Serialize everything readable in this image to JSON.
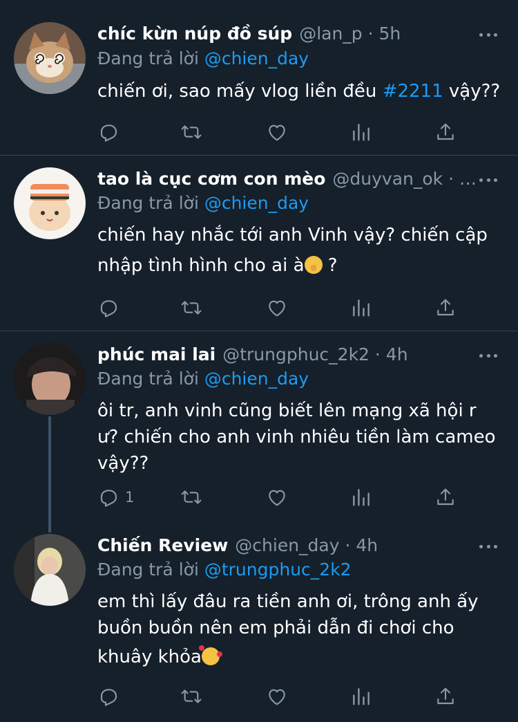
{
  "tweets": [
    {
      "name": "chíc kừn núp đồ súp",
      "handle": "@lan_p",
      "time": "5h",
      "meta": "@lan_p · 5h",
      "reply_prefix": "Đang trả lời ",
      "reply_to": "@chien_day",
      "text_before": "chiến ơi, sao mấy vlog liền đều ",
      "hashtag": "#2211",
      "text_after": " vậy??",
      "avatar": "cat-with-spiral-eyes",
      "reply_count": ""
    },
    {
      "name": "tao là cục cơm con mèo",
      "meta": "@duyvan_ok · …",
      "reply_prefix": "Đang trả lời ",
      "reply_to": "@chien_day",
      "text_line1": "chiến hay nhắc tới anh Vinh vậy? chiến cập",
      "text_line2": "nhập tình hình cho ai à",
      "text_line2_end": " ?",
      "emoji": "shushing-face-emoji",
      "avatar": "cat-with-sushi-hat",
      "reply_count": ""
    },
    {
      "name": "phúc mai lai",
      "meta": "@trungphuc_2k2 · 4h",
      "reply_prefix": "Đang trả lời ",
      "reply_to": "@chien_day",
      "text_line1": "ôi tr, anh vinh cũng biết lên mạng xã hội r",
      "text_line2": "ư? chiến cho anh vinh nhiêu tiền làm cameo",
      "text_line3": "vậy??",
      "avatar": "person-photo",
      "reply_count": "1"
    },
    {
      "name": "Chiến Review",
      "meta": "@chien_day · 4h",
      "reply_prefix": "Đang trả lời ",
      "reply_to": "@trungphuc_2k2",
      "text_line1": "em thì lấy đâu ra tiền anh ơi, trông anh ấy",
      "text_line2": "buồn buồn nên em phải dẫn đi chơi cho",
      "text_line3": "khuây khỏa",
      "emoji": "smiling-face-with-hearts-emoji",
      "avatar": "person-photo-blond",
      "reply_count": ""
    }
  ],
  "actions": [
    "reply-icon",
    "retweet-icon",
    "like-icon",
    "analytics-icon",
    "share-icon"
  ],
  "colors": {
    "background": "#15202b",
    "separator": "#38444d",
    "secondary_text": "#8899a6",
    "link": "#1d9bf0",
    "icon": "#8899a6"
  }
}
